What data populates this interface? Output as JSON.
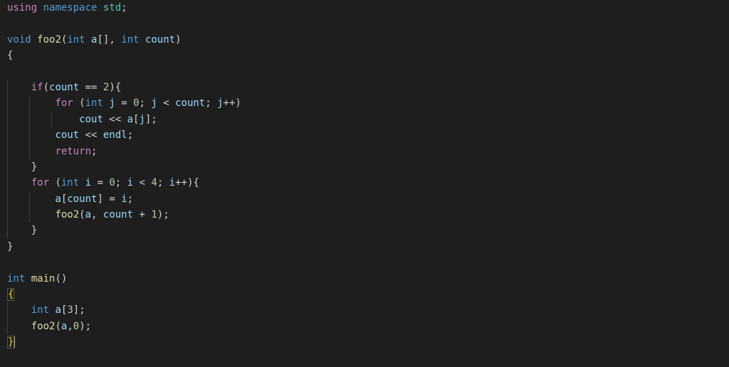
{
  "code": {
    "lines": [
      {
        "indent": 0,
        "tokens": [
          {
            "t": "using",
            "c": "kw-pink"
          },
          {
            "t": " ",
            "c": ""
          },
          {
            "t": "namespace",
            "c": "kw-blue"
          },
          {
            "t": " ",
            "c": ""
          },
          {
            "t": "std",
            "c": "kw-teal"
          },
          {
            "t": ";",
            "c": "punct"
          }
        ]
      },
      {
        "indent": 0,
        "tokens": []
      },
      {
        "indent": 0,
        "tokens": [
          {
            "t": "void",
            "c": "kw-blue"
          },
          {
            "t": " ",
            "c": ""
          },
          {
            "t": "foo2",
            "c": "fn-yellow"
          },
          {
            "t": "(",
            "c": "paren"
          },
          {
            "t": "int",
            "c": "kw-blue"
          },
          {
            "t": " ",
            "c": ""
          },
          {
            "t": "a",
            "c": "var"
          },
          {
            "t": "[]",
            "c": "punct"
          },
          {
            "t": ", ",
            "c": "punct"
          },
          {
            "t": "int",
            "c": "kw-blue"
          },
          {
            "t": " ",
            "c": ""
          },
          {
            "t": "count",
            "c": "var"
          },
          {
            "t": ")",
            "c": "paren"
          }
        ]
      },
      {
        "indent": 0,
        "tokens": [
          {
            "t": "{",
            "c": "punct"
          }
        ]
      },
      {
        "indent": 0,
        "tokens": []
      },
      {
        "indent": 1,
        "tokens": [
          {
            "t": "if",
            "c": "kw-pink"
          },
          {
            "t": "(",
            "c": "paren"
          },
          {
            "t": "count",
            "c": "var"
          },
          {
            "t": " == ",
            "c": "punct"
          },
          {
            "t": "2",
            "c": "num"
          },
          {
            "t": ")",
            "c": "paren"
          },
          {
            "t": "{",
            "c": "punct"
          }
        ]
      },
      {
        "indent": 2,
        "tokens": [
          {
            "t": "for",
            "c": "kw-pink"
          },
          {
            "t": " (",
            "c": "paren"
          },
          {
            "t": "int",
            "c": "kw-blue"
          },
          {
            "t": " ",
            "c": ""
          },
          {
            "t": "j",
            "c": "var"
          },
          {
            "t": " = ",
            "c": "punct"
          },
          {
            "t": "0",
            "c": "num"
          },
          {
            "t": "; ",
            "c": "punct"
          },
          {
            "t": "j",
            "c": "var"
          },
          {
            "t": " < ",
            "c": "punct"
          },
          {
            "t": "count",
            "c": "var"
          },
          {
            "t": "; ",
            "c": "punct"
          },
          {
            "t": "j",
            "c": "var"
          },
          {
            "t": "++)",
            "c": "punct"
          }
        ]
      },
      {
        "indent": 3,
        "tokens": [
          {
            "t": "cout",
            "c": "var"
          },
          {
            "t": " << ",
            "c": "punct"
          },
          {
            "t": "a",
            "c": "var"
          },
          {
            "t": "[",
            "c": "punct"
          },
          {
            "t": "j",
            "c": "var"
          },
          {
            "t": "];",
            "c": "punct"
          }
        ]
      },
      {
        "indent": 2,
        "tokens": [
          {
            "t": "cout",
            "c": "var"
          },
          {
            "t": " << ",
            "c": "punct"
          },
          {
            "t": "endl",
            "c": "var"
          },
          {
            "t": ";",
            "c": "punct"
          }
        ]
      },
      {
        "indent": 2,
        "tokens": [
          {
            "t": "return",
            "c": "kw-pink"
          },
          {
            "t": ";",
            "c": "punct"
          }
        ]
      },
      {
        "indent": 1,
        "tokens": [
          {
            "t": "}",
            "c": "punct"
          }
        ]
      },
      {
        "indent": 1,
        "tokens": [
          {
            "t": "for",
            "c": "kw-pink"
          },
          {
            "t": " (",
            "c": "paren"
          },
          {
            "t": "int",
            "c": "kw-blue"
          },
          {
            "t": " ",
            "c": ""
          },
          {
            "t": "i",
            "c": "var"
          },
          {
            "t": " = ",
            "c": "punct"
          },
          {
            "t": "0",
            "c": "num"
          },
          {
            "t": "; ",
            "c": "punct"
          },
          {
            "t": "i",
            "c": "var"
          },
          {
            "t": " < ",
            "c": "punct"
          },
          {
            "t": "4",
            "c": "num"
          },
          {
            "t": "; ",
            "c": "punct"
          },
          {
            "t": "i",
            "c": "var"
          },
          {
            "t": "++){",
            "c": "punct"
          }
        ]
      },
      {
        "indent": 2,
        "tokens": [
          {
            "t": "a",
            "c": "var"
          },
          {
            "t": "[",
            "c": "punct"
          },
          {
            "t": "count",
            "c": "var"
          },
          {
            "t": "] = ",
            "c": "punct"
          },
          {
            "t": "i",
            "c": "var"
          },
          {
            "t": ";",
            "c": "punct"
          }
        ]
      },
      {
        "indent": 2,
        "tokens": [
          {
            "t": "foo2",
            "c": "fn-yellow"
          },
          {
            "t": "(",
            "c": "paren"
          },
          {
            "t": "a",
            "c": "var"
          },
          {
            "t": ", ",
            "c": "punct"
          },
          {
            "t": "count",
            "c": "var"
          },
          {
            "t": " + ",
            "c": "punct"
          },
          {
            "t": "1",
            "c": "num"
          },
          {
            "t": ");",
            "c": "punct"
          }
        ]
      },
      {
        "indent": 1,
        "tokens": [
          {
            "t": "}",
            "c": "punct"
          }
        ]
      },
      {
        "indent": 0,
        "tokens": [
          {
            "t": "}",
            "c": "punct"
          }
        ]
      },
      {
        "indent": 0,
        "tokens": []
      },
      {
        "indent": 0,
        "tokens": [
          {
            "t": "int",
            "c": "kw-blue"
          },
          {
            "t": " ",
            "c": ""
          },
          {
            "t": "main",
            "c": "fn-yellow"
          },
          {
            "t": "()",
            "c": "paren"
          }
        ]
      },
      {
        "indent": 0,
        "tokens": [
          {
            "t": "{",
            "c": "bracket"
          }
        ],
        "boxed": true
      },
      {
        "indent": 1,
        "tokens": [
          {
            "t": "int",
            "c": "kw-blue"
          },
          {
            "t": " ",
            "c": ""
          },
          {
            "t": "a",
            "c": "var"
          },
          {
            "t": "[",
            "c": "punct"
          },
          {
            "t": "3",
            "c": "num"
          },
          {
            "t": "];",
            "c": "punct"
          }
        ]
      },
      {
        "indent": 1,
        "tokens": [
          {
            "t": "foo2",
            "c": "fn-yellow"
          },
          {
            "t": "(",
            "c": "paren"
          },
          {
            "t": "a",
            "c": "var"
          },
          {
            "t": ",",
            "c": "punct"
          },
          {
            "t": "0",
            "c": "num"
          },
          {
            "t": ");",
            "c": "punct"
          }
        ]
      },
      {
        "indent": 0,
        "tokens": [
          {
            "t": "}",
            "c": "bracket"
          }
        ],
        "boxed": true,
        "cursor": true
      }
    ]
  },
  "settings": {
    "indentSize": 4,
    "indentUnit": "    "
  }
}
